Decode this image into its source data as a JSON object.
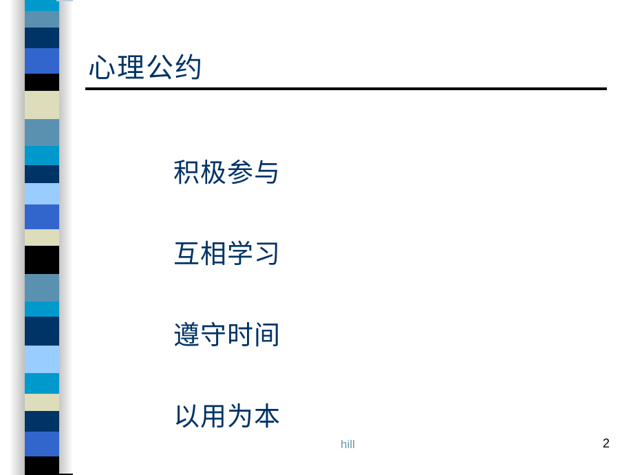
{
  "slide": {
    "title": "心理公约",
    "items": [
      {
        "label": "积极参与"
      },
      {
        "label": "互相学习"
      },
      {
        "label": "遵守时间"
      },
      {
        "label": "以用为本"
      }
    ],
    "footer": "hill",
    "page_number": "2"
  },
  "colors": {
    "title": "#003366",
    "text": "#003366",
    "footer": "#6699AA",
    "rule": "#000000",
    "stripe_palette": [
      "#0099CC",
      "#5B91B0",
      "#003366",
      "#3366CC",
      "#000000",
      "#DDDDBB",
      "#5B91B0",
      "#0099CC",
      "#003366",
      "#99CCFF",
      "#3366CC",
      "#DDDDBB",
      "#000000",
      "#5B91B0",
      "#0099CC",
      "#003366",
      "#99CCFF",
      "#0099CC",
      "#DDDDBB",
      "#003366",
      "#3366CC",
      "#000000"
    ]
  }
}
